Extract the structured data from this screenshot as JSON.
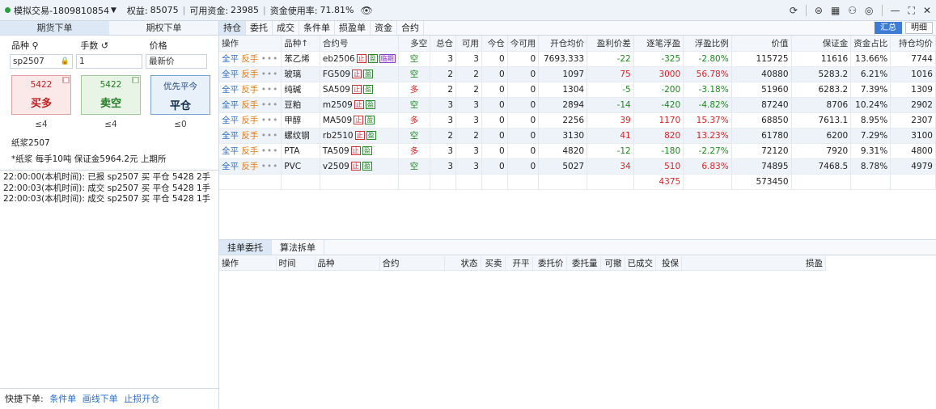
{
  "topbar": {
    "account": "模拟交易-1809810854",
    "equity_label": "权益:",
    "equity": "85075",
    "available_label": "可用资金:",
    "available": "23985",
    "usage_label": "资金使用率:",
    "usage": "71.81%"
  },
  "left": {
    "tabs": [
      "期货下单",
      "期权下单"
    ],
    "labels": {
      "product": "品种",
      "qty": "手数",
      "price": "价格"
    },
    "product_value": "sp2507",
    "qty_value": "1",
    "price_value": "最新价",
    "buy": {
      "price": "5422",
      "label": "买多",
      "limit": "≤4"
    },
    "sell": {
      "price": "5422",
      "label": "卖空",
      "limit": "≤4"
    },
    "close": {
      "top": "优先平今",
      "label": "平仓",
      "limit": "≤0"
    },
    "info_name": "纸浆2507",
    "info_detail": "*纸浆 每手10吨 保证金5964.2元 上期所",
    "logs": [
      "22:00:00(本机时间): 已报 sp2507 买 平仓 5428 2手",
      "22:00:03(本机时间): 成交 sp2507 买 平仓 5428 1手",
      "22:00:03(本机时间): 成交 sp2507 买 平仓 5428 1手"
    ],
    "quick_label": "快捷下单:",
    "quick_links": [
      "条件单",
      "画线下单",
      "止损开仓"
    ]
  },
  "right": {
    "tabs": [
      "持仓",
      "委托",
      "成交",
      "条件单",
      "损盈单",
      "资金",
      "合约"
    ],
    "buttons": [
      "汇总",
      "明细"
    ],
    "headers": [
      "操作",
      "品种↑",
      "合约号",
      "多空",
      "总仓",
      "可用",
      "今仓",
      "今可用",
      "开仓均价",
      "盈利价差",
      "逐笔浮盈",
      "浮盈比例",
      "价值",
      "保证金",
      "资金占比",
      "持仓均价"
    ],
    "op": {
      "close": "全平",
      "reverse": "反手",
      "more": "•••"
    },
    "tags": {
      "stop": "止",
      "profit": "盈",
      "temp": "临期"
    },
    "rows": [
      {
        "name": "苯乙烯",
        "code": "eb2506",
        "side": "空",
        "total": "3",
        "avail": "3",
        "today": "0",
        "today_avail": "0",
        "open_avg": "7693.333",
        "spread": "-22",
        "float": "-325",
        "ratio": "-2.80%",
        "value": "115725",
        "margin": "11616",
        "share": "13.66%",
        "hold_avg": "7744"
      },
      {
        "name": "玻璃",
        "code": "FG509",
        "side": "空",
        "total": "2",
        "avail": "2",
        "today": "0",
        "today_avail": "0",
        "open_avg": "1097",
        "spread": "75",
        "float": "3000",
        "ratio": "56.78%",
        "value": "40880",
        "margin": "5283.2",
        "share": "6.21%",
        "hold_avg": "1016"
      },
      {
        "name": "纯碱",
        "code": "SA509",
        "side": "多",
        "total": "2",
        "avail": "2",
        "today": "0",
        "today_avail": "0",
        "open_avg": "1304",
        "spread": "-5",
        "float": "-200",
        "ratio": "-3.18%",
        "value": "51960",
        "margin": "6283.2",
        "share": "7.39%",
        "hold_avg": "1309"
      },
      {
        "name": "豆粕",
        "code": "m2509",
        "side": "空",
        "total": "3",
        "avail": "3",
        "today": "0",
        "today_avail": "0",
        "open_avg": "2894",
        "spread": "-14",
        "float": "-420",
        "ratio": "-4.82%",
        "value": "87240",
        "margin": "8706",
        "share": "10.24%",
        "hold_avg": "2902"
      },
      {
        "name": "甲醇",
        "code": "MA509",
        "side": "多",
        "total": "3",
        "avail": "3",
        "today": "0",
        "today_avail": "0",
        "open_avg": "2256",
        "spread": "39",
        "float": "1170",
        "ratio": "15.37%",
        "value": "68850",
        "margin": "7613.1",
        "share": "8.95%",
        "hold_avg": "2307"
      },
      {
        "name": "螺纹钢",
        "code": "rb2510",
        "side": "空",
        "total": "2",
        "avail": "2",
        "today": "0",
        "today_avail": "0",
        "open_avg": "3130",
        "spread": "41",
        "float": "820",
        "ratio": "13.23%",
        "value": "61780",
        "margin": "6200",
        "share": "7.29%",
        "hold_avg": "3100"
      },
      {
        "name": "PTA",
        "code": "TA509",
        "side": "多",
        "total": "3",
        "avail": "3",
        "today": "0",
        "today_avail": "0",
        "open_avg": "4820",
        "spread": "-12",
        "float": "-180",
        "ratio": "-2.27%",
        "value": "72120",
        "margin": "7920",
        "share": "9.31%",
        "hold_avg": "4800"
      },
      {
        "name": "PVC",
        "code": "v2509",
        "side": "空",
        "total": "3",
        "avail": "3",
        "today": "0",
        "today_avail": "0",
        "open_avg": "5027",
        "spread": "34",
        "float": "510",
        "ratio": "6.83%",
        "value": "74895",
        "margin": "7468.5",
        "share": "8.78%",
        "hold_avg": "4979"
      }
    ],
    "totals": {
      "float": "4375",
      "value": "573450"
    },
    "lower_tabs": [
      "挂单委托",
      "算法拆单"
    ],
    "order_headers": [
      "操作",
      "时间",
      "品种",
      "合约",
      "状态",
      "买卖",
      "开平",
      "委托价",
      "委托量",
      "可撤",
      "已成交",
      "投保",
      "损盈"
    ]
  },
  "colors": {
    "up": "#d22222",
    "down": "#1c8a1c",
    "accent": "#3d7bd6"
  }
}
